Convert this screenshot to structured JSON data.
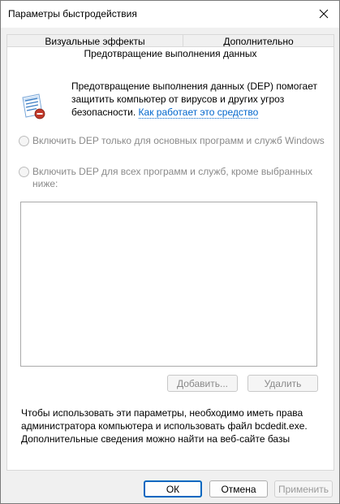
{
  "window": {
    "title": "Параметры быстродействия"
  },
  "tabs": [
    {
      "label": "Визуальные эффекты"
    },
    {
      "label": "Дополнительно"
    },
    {
      "label": "Предотвращение выполнения данных"
    }
  ],
  "dep": {
    "intro_text": "Предотвращение выполнения данных (DEP) помогает защитить компьютер от вирусов и других угроз безопасности. ",
    "intro_link": "Как работает это средство",
    "option_essential": "Включить DEP только для основных программ и служб Windows",
    "option_all": "Включить DEP для всех программ и служб, кроме выбранных ниже:",
    "add_button": "Добавить...",
    "remove_button": "Удалить",
    "note": "Чтобы использовать эти параметры, необходимо иметь права администратора компьютера и использовать файл bcdedit.exe. Дополнительные сведения можно найти на веб-сайте базы"
  },
  "footer": {
    "ok": "ОК",
    "cancel": "Отмена",
    "apply": "Применить"
  },
  "icons": {
    "close": "close-icon",
    "dep": "dep-shield-icon"
  }
}
